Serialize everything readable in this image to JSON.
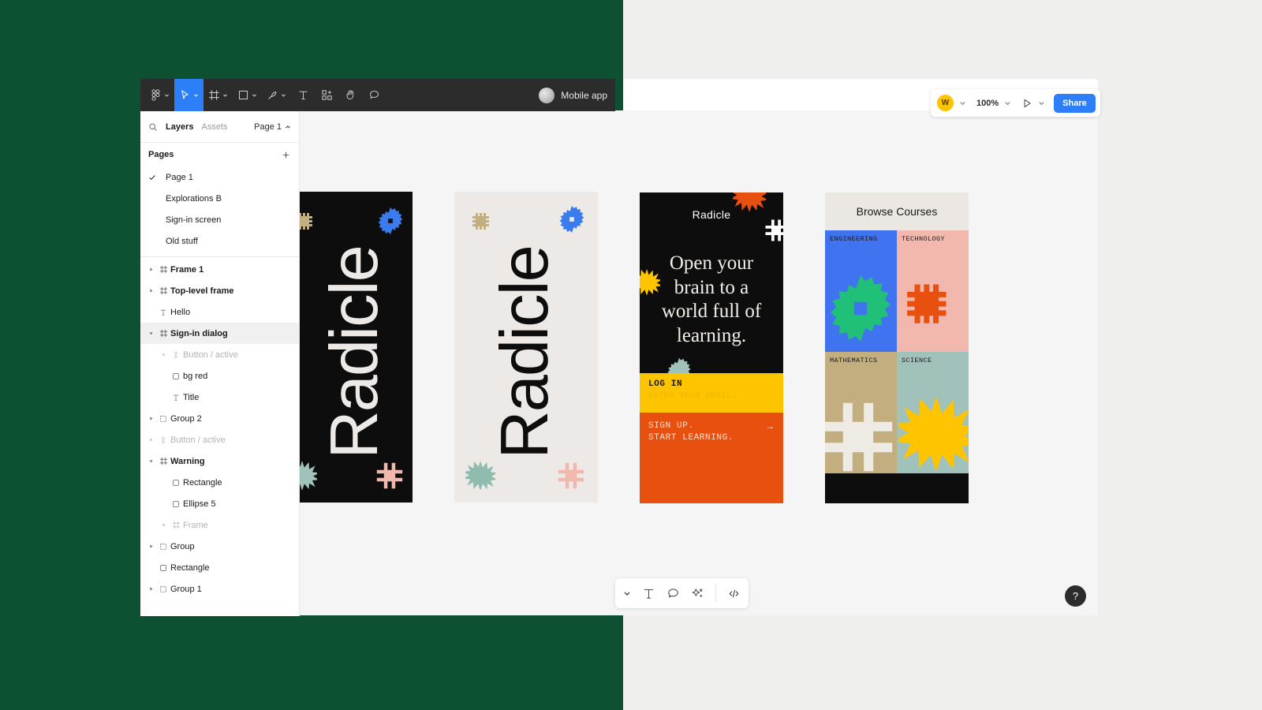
{
  "app": {
    "name": "Figma",
    "filename": "Mobile app"
  },
  "toolbar": {
    "tools": [
      {
        "name": "figma-logo-icon",
        "label": "Figma",
        "has_caret": true,
        "active": false
      },
      {
        "name": "move-tool-icon",
        "label": "Move",
        "has_caret": true,
        "active": true
      },
      {
        "name": "frame-tool-icon",
        "label": "Frame",
        "has_caret": true,
        "active": false
      },
      {
        "name": "shape-tool-icon",
        "label": "Rectangle",
        "has_caret": true,
        "active": false
      },
      {
        "name": "pen-tool-icon",
        "label": "Pen",
        "has_caret": true,
        "active": false
      },
      {
        "name": "text-tool-icon",
        "label": "Text",
        "has_caret": false,
        "active": false
      },
      {
        "name": "resources-icon",
        "label": "Resources",
        "has_caret": false,
        "active": false
      },
      {
        "name": "hand-tool-icon",
        "label": "Hand",
        "has_caret": false,
        "active": false
      },
      {
        "name": "comment-tool-icon",
        "label": "Comment",
        "has_caret": false,
        "active": false
      }
    ]
  },
  "panel": {
    "search_placeholder": "Search",
    "tabs": [
      {
        "label": "Layers",
        "selected": true
      },
      {
        "label": "Assets",
        "selected": false
      }
    ],
    "page_selector": "Page 1",
    "pages_title": "Pages",
    "add_page_label": "+",
    "pages": [
      {
        "label": "Page 1",
        "current": true
      },
      {
        "label": "Explorations B",
        "current": false
      },
      {
        "label": "Sign-in screen",
        "current": false
      },
      {
        "label": "Old stuff",
        "current": false
      }
    ],
    "layers": [
      {
        "label": "Frame 1",
        "icon": "frame-icon",
        "indent": 0,
        "arrow": "collapsed",
        "bold": true,
        "dim": false,
        "selected": false
      },
      {
        "label": "Top-level frame",
        "icon": "frame-icon",
        "indent": 0,
        "arrow": "collapsed",
        "bold": true,
        "dim": false,
        "selected": false
      },
      {
        "label": "Hello",
        "icon": "text-icon",
        "indent": 0,
        "arrow": "none",
        "bold": false,
        "dim": false,
        "selected": false
      },
      {
        "label": "Sign-in dialog",
        "icon": "frame-icon",
        "indent": 0,
        "arrow": "expanded",
        "bold": true,
        "dim": false,
        "selected": true
      },
      {
        "label": "Button / active",
        "icon": "component-icon",
        "indent": 1,
        "arrow": "collapsed",
        "bold": false,
        "dim": true,
        "selected": false
      },
      {
        "label": "bg red",
        "icon": "rectangle-icon",
        "indent": 1,
        "arrow": "none",
        "bold": false,
        "dim": false,
        "selected": false
      },
      {
        "label": "Title",
        "icon": "text-icon",
        "indent": 1,
        "arrow": "none",
        "bold": false,
        "dim": false,
        "selected": false
      },
      {
        "label": "Group 2",
        "icon": "group-icon",
        "indent": 0,
        "arrow": "collapsed",
        "bold": false,
        "dim": false,
        "selected": false
      },
      {
        "label": "Button / active",
        "icon": "component-icon",
        "indent": 0,
        "arrow": "collapsed",
        "bold": false,
        "dim": true,
        "selected": false
      },
      {
        "label": "Warning",
        "icon": "frame-icon",
        "indent": 0,
        "arrow": "expanded",
        "bold": true,
        "dim": false,
        "selected": false
      },
      {
        "label": "Rectangle",
        "icon": "rectangle-icon",
        "indent": 1,
        "arrow": "none",
        "bold": false,
        "dim": false,
        "selected": false
      },
      {
        "label": "Ellipse 5",
        "icon": "rectangle-icon",
        "indent": 1,
        "arrow": "none",
        "bold": false,
        "dim": false,
        "selected": false
      },
      {
        "label": "Frame",
        "icon": "frame-icon",
        "indent": 1,
        "arrow": "collapsed",
        "bold": false,
        "dim": true,
        "selected": false
      },
      {
        "label": "Group",
        "icon": "group-icon",
        "indent": 0,
        "arrow": "collapsed",
        "bold": false,
        "dim": false,
        "selected": false
      },
      {
        "label": "Rectangle",
        "icon": "rectangle-icon",
        "indent": 0,
        "arrow": "none",
        "bold": false,
        "dim": false,
        "selected": false
      },
      {
        "label": "Group 1",
        "icon": "group-icon",
        "indent": 0,
        "arrow": "collapsed",
        "bold": false,
        "dim": false,
        "selected": false
      }
    ]
  },
  "top_controls": {
    "avatar_initial": "W",
    "avatar_color": "#ffc400",
    "zoom": "100%",
    "share_label": "Share",
    "present_icon": "play-icon"
  },
  "bottom_toolbar": {
    "items": [
      {
        "name": "chevron-down-icon",
        "label": "More"
      },
      {
        "name": "text-tool-icon",
        "label": "Text"
      },
      {
        "name": "comment-tool-icon",
        "label": "Comment"
      },
      {
        "name": "ai-sparkle-icon",
        "label": "Actions"
      },
      {
        "name": "dev-mode-icon",
        "label": "Dev mode"
      }
    ],
    "help_label": "?"
  },
  "artboards": {
    "dark": {
      "word": "Radicle",
      "bg": "#0d0d0d",
      "fg": "#ece9e6"
    },
    "light": {
      "word": "Radicle",
      "bg": "#ece9e6",
      "fg": "#0d0d0d"
    }
  },
  "mock_hero": {
    "brand": "Radicle",
    "headline": "Open your brain to a world full of learning.",
    "login_label": "LOG IN",
    "login_placeholder": "ENTER YOUR EMAIL.",
    "signup_line_1": "SIGN UP.",
    "signup_line_2": "START LEARNING.",
    "signup_arrow": "→",
    "bg": "#0d0d0d",
    "login_bg": "#ffc400",
    "signup_bg": "#e8500f"
  },
  "mock_browse": {
    "title": "Browse Courses",
    "bg": "#ebe8e4",
    "cells": [
      {
        "label": "ENGINEERING",
        "bg": "#4073f0",
        "shape": "gear-shape",
        "shape_color": "#21c078"
      },
      {
        "label": "TECHNOLOGY",
        "bg": "#f2b7ad",
        "shape": "chip-shape",
        "shape_color": "#e8500f"
      },
      {
        "label": "MATHEMATICS",
        "bg": "#c2ae7e",
        "shape": "hash-shape",
        "shape_color": "#eeeae4"
      },
      {
        "label": "SCIENCE",
        "bg": "#a0c2ba",
        "shape": "sunburst-shape",
        "shape_color": "#ffc400"
      }
    ]
  },
  "decorations": {
    "dark_artboard": [
      {
        "name": "chip-shape",
        "color": "#c2ae7e"
      },
      {
        "name": "gear-shape",
        "color": "#3a7cf0"
      },
      {
        "name": "sunburst-shape",
        "color": "#a0c2ba"
      },
      {
        "name": "hash-shape",
        "color": "#f2b7ad"
      }
    ],
    "light_artboard": [
      {
        "name": "chip-shape",
        "color": "#c2ae7e"
      },
      {
        "name": "gear-shape",
        "color": "#3a7cf0"
      },
      {
        "name": "sunburst-shape",
        "color": "#8fbcae"
      },
      {
        "name": "hash-shape",
        "color": "#f2b7ad"
      }
    ],
    "hero": [
      {
        "name": "sunburst-shape",
        "color": "#e8500f"
      },
      {
        "name": "hash-shape",
        "color": "#ffffff"
      },
      {
        "name": "sunburst-shape",
        "color": "#ffc400"
      },
      {
        "name": "gear-shape",
        "color": "#a0c2ba"
      },
      {
        "name": "sunburst-shape",
        "color": "#3a7cf0"
      }
    ]
  }
}
